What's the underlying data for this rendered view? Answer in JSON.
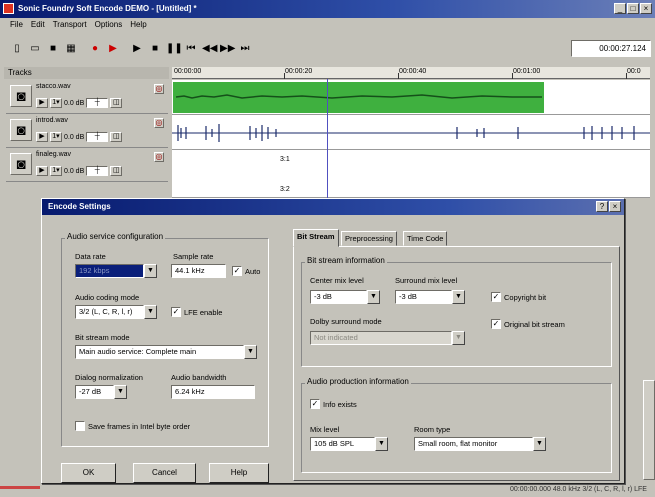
{
  "app": {
    "title": "Sonic Foundry Soft Encode DEMO - [Untitled] *",
    "menu": [
      "File",
      "Edit",
      "Transport",
      "Options",
      "Help"
    ],
    "toolbar_icons": [
      "new-icon",
      "open-icon",
      "save-icon",
      "save-all-icon",
      "record-icon",
      "play-all-icon",
      "play-icon",
      "stop-icon",
      "pause-icon",
      "go-start-icon",
      "rewind-icon",
      "forward-icon",
      "go-end-icon"
    ],
    "timecode": "00:00:27.124"
  },
  "tracks": {
    "header": "Tracks",
    "items": [
      {
        "name": "stacco.wav",
        "gain": "0.0 dB"
      },
      {
        "name": "introd.wav",
        "gain": "0.0 dB"
      },
      {
        "name": "finaleg.wav",
        "gain": "0.0 dB"
      }
    ]
  },
  "ruler": {
    "marks": [
      "00:00:00",
      "00:00:20",
      "00:00:40",
      "00:01:00",
      "00:0"
    ]
  },
  "lane_labels": [
    "3:1",
    "3:2"
  ],
  "colors": {
    "clip_green": "#3fb03f",
    "waveform": "#1a2a6a",
    "titlebar": "#071a6e"
  },
  "dialog": {
    "title": "Encode Settings",
    "audio_config": {
      "group_label": "Audio service configuration",
      "data_rate_label": "Data rate",
      "data_rate_value": "192 kbps",
      "sample_rate_label": "Sample rate",
      "sample_rate_value": "44.1 kHz",
      "auto_label": "Auto",
      "coding_mode_label": "Audio coding mode",
      "coding_mode_value": "3/2 (L, C, R, l, r)",
      "lfe_label": "LFE enable",
      "bitstream_mode_label": "Bit stream mode",
      "bitstream_mode_value": "Main audio service: Complete main",
      "dialog_norm_label": "Dialog normalization",
      "dialog_norm_value": "-27 dB",
      "bandwidth_label": "Audio bandwidth",
      "bandwidth_value": "6.24 kHz",
      "save_frames_label": "Save frames in Intel byte order"
    },
    "tabs": [
      "Bit Stream",
      "Preprocessing",
      "Time Code"
    ],
    "bitstream": {
      "group_label": "Bit stream information",
      "center_mix_label": "Center mix level",
      "center_mix_value": "-3 dB",
      "surround_mix_label": "Surround mix level",
      "surround_mix_value": "-3 dB",
      "copyright_label": "Copyright bit",
      "original_label": "Original bit stream",
      "dolby_label": "Dolby surround mode",
      "dolby_value": "Not indicated"
    },
    "production": {
      "group_label": "Audio production information",
      "info_exists_label": "Info exists",
      "mix_level_label": "Mix level",
      "mix_level_value": "105 dB SPL",
      "room_type_label": "Room type",
      "room_type_value": "Small room, flat monitor"
    },
    "buttons": {
      "ok": "OK",
      "cancel": "Cancel",
      "help": "Help"
    }
  },
  "status": {
    "text": "00:00:00.000 48.0 kHz  3/2 (L, C, R, l, r) LFE"
  }
}
